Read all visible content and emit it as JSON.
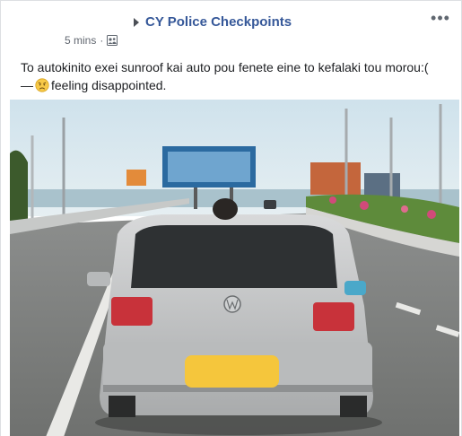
{
  "post": {
    "page_name": "CY Police Checkpoints",
    "time": "5 mins",
    "separator": "·",
    "more_label": "•••",
    "text_line1": "To autokinito exei sunroof kai auto pou fenete eine to kefalaki tou morou:(",
    "feeling_prefix": "—",
    "feeling_text": "feeling disappointed.",
    "icons": {
      "caret": "right-caret-icon",
      "privacy": "friends-privacy-icon",
      "feeling": "disappointed-face-icon",
      "more": "more-options-icon"
    },
    "colors": {
      "link": "#365899",
      "meta": "#616770",
      "text": "#1c1e21"
    }
  }
}
